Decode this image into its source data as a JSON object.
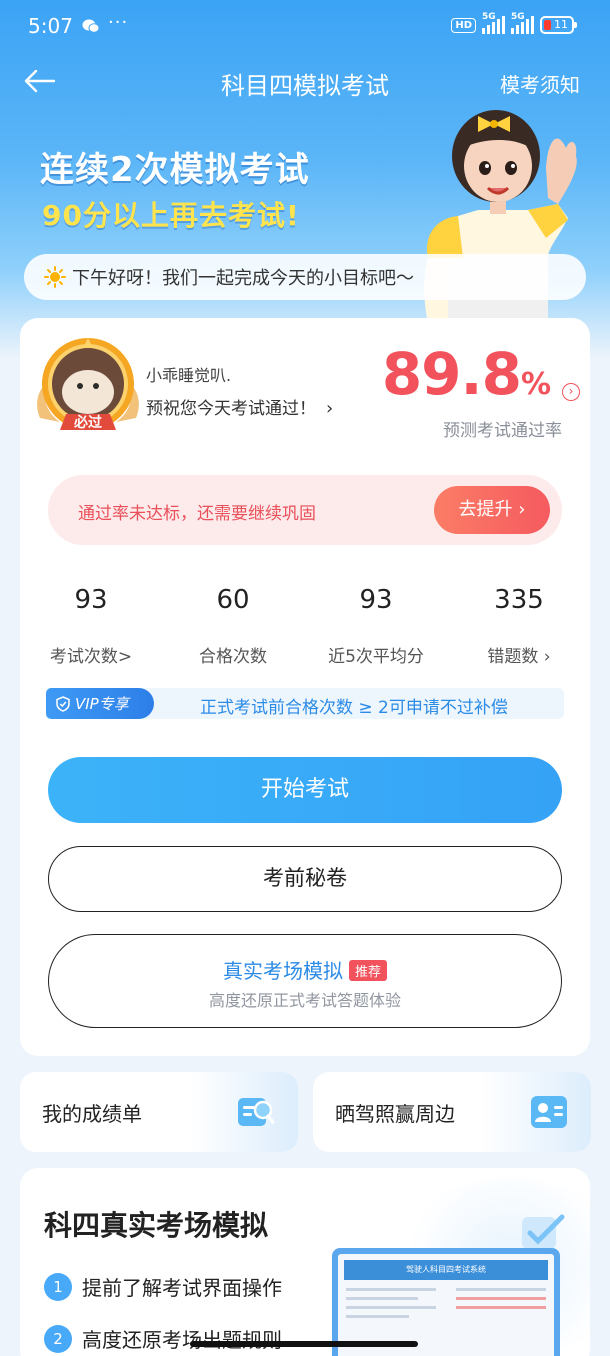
{
  "status_bar": {
    "time": "5:07",
    "dots": "···",
    "hd": "HD",
    "net1": "5G",
    "net2": "5G",
    "battery": "11"
  },
  "nav": {
    "title": "科目四模拟考试",
    "right_link": "模考须知"
  },
  "banner": {
    "line1": "连续2次模拟考试",
    "line2": "90分以上再去考试!"
  },
  "greeting": "下午好呀！我们一起完成今天的小目标吧～",
  "profile": {
    "badge": "必过",
    "name": "小乖睡觉叭.",
    "wish": "预祝您今天考试通过！",
    "chevron": "›"
  },
  "pass_rate": {
    "value": "89.8",
    "unit": "%",
    "info_glyph": "›",
    "label": "预测考试通过率"
  },
  "warning": {
    "text": "通过率未达标，还需要继续巩固",
    "button": "去提升 ›"
  },
  "stats": [
    {
      "value": "93",
      "label": "考试次数>"
    },
    {
      "value": "60",
      "label": "合格次数"
    },
    {
      "value": "93",
      "label": "近5次平均分"
    },
    {
      "value": "335",
      "label": "错题数 ›"
    }
  ],
  "vip": {
    "tag": "VIP专享",
    "text": "正式考试前合格次数 ≥ 2可申请不过补偿"
  },
  "buttons": {
    "start": "开始考试",
    "secret": "考前秘卷",
    "real_title": "真实考场模拟",
    "real_tag": "推荐",
    "real_sub": "高度还原正式考试答题体验"
  },
  "mini_cards": {
    "left": "我的成绩单",
    "right": "晒驾照赢周边"
  },
  "sim_section": {
    "title": "科四真实考场模拟",
    "item1_num": "1",
    "item1": "提前了解考试界面操作",
    "item2_num": "2",
    "item2": "高度还原考场出题规则",
    "screen_header": "驾驶人科目四考试系统"
  },
  "colors": {
    "primary": "#3ba3f5",
    "danger": "#f2525c",
    "accent_yellow": "#ffe44d"
  }
}
